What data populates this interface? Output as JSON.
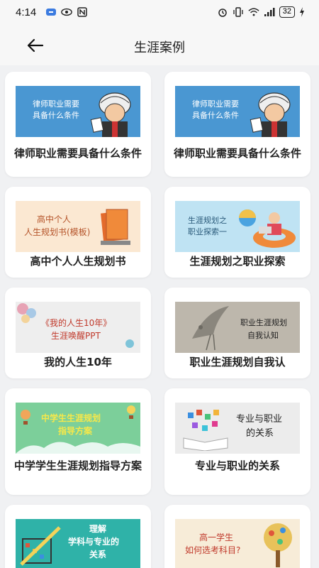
{
  "status": {
    "time": "4:14",
    "battery": "32"
  },
  "header": {
    "title": "生涯案例"
  },
  "cards": [
    {
      "caption": "律师职业需要具备什么条件",
      "thumb_text": "律师职业需要具备什么条件",
      "thumb_bg": "#4a97d2"
    },
    {
      "caption": "律师职业需要具备什么条件",
      "thumb_text": "律师职业需要具备什么条件",
      "thumb_bg": "#4a97d2"
    },
    {
      "caption": "高中个人人生规划书",
      "thumb_text1": "高中个人",
      "thumb_text2": "人生规划书(模板)",
      "thumb_bg": "#fbe8d2"
    },
    {
      "caption": "生涯规划之职业探索",
      "thumb_text1": "生涯规划之",
      "thumb_text2": "职业探索一",
      "thumb_bg": "#bfe3f3"
    },
    {
      "caption": "我的人生10年",
      "thumb_text1": "《我的人生10年》",
      "thumb_text2": "生涯唤醒PPT",
      "thumb_bg": "#eeeeee"
    },
    {
      "caption": "职业生涯规划自我认",
      "thumb_text1": "职业生涯规划",
      "thumb_text2": "自我认知",
      "thumb_bg": "#bdb7ac"
    },
    {
      "caption": "中学学生生涯规划指导方案",
      "thumb_text1": "中学生生涯规划",
      "thumb_text2": "指导方案",
      "thumb_bg": "#7ccf9a"
    },
    {
      "caption": "专业与职业的关系",
      "thumb_text1": "专业与职业",
      "thumb_text2": "的关系",
      "thumb_bg": "#ececec"
    },
    {
      "caption": "",
      "thumb_text1": "理解",
      "thumb_text2": "学科与专业的",
      "thumb_text3": "关系",
      "thumb_bg": "#2fb2a8"
    },
    {
      "caption": "",
      "thumb_text1": "高一学生",
      "thumb_text2": "如何选考科目?",
      "thumb_bg": "#f7ecd8"
    }
  ]
}
